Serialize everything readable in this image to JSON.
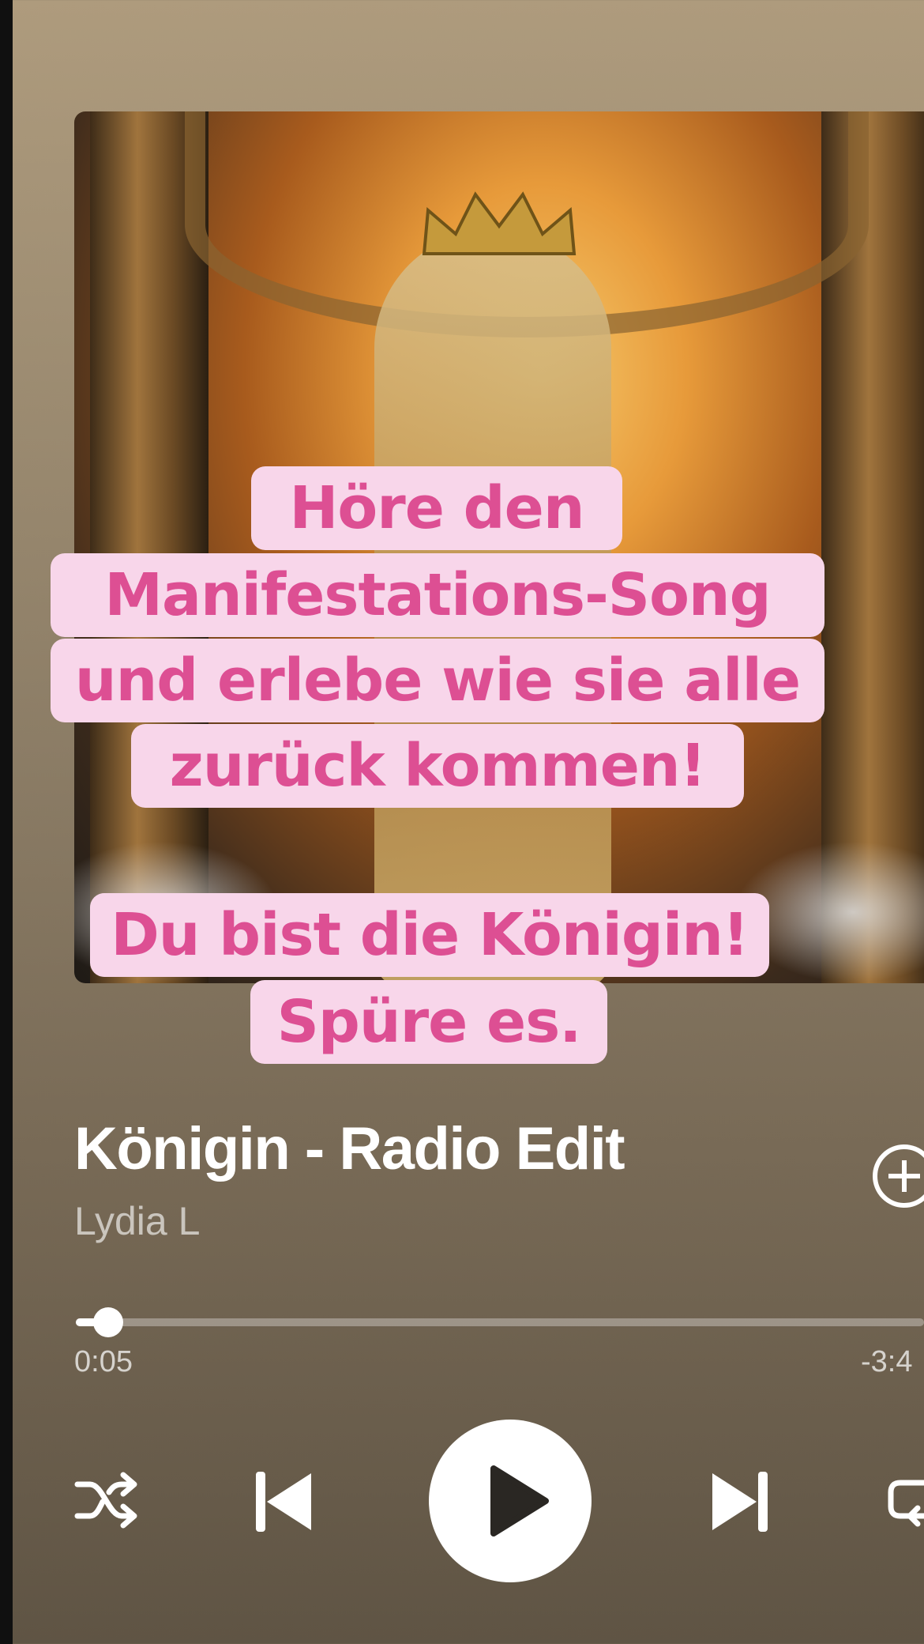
{
  "overlay": {
    "caption_1": [
      "Höre den",
      "Manifestations-Song",
      "und erlebe wie sie alle",
      "zurück kommen!"
    ],
    "caption_2": [
      "Du bist die Königin!",
      "Spüre es."
    ]
  },
  "track": {
    "title": "Königin - Radio Edit",
    "artist": "Lydia L"
  },
  "progress": {
    "elapsed": "0:05",
    "remaining": "-3:4",
    "fraction": 0.025
  },
  "controls": [
    "shuffle-icon",
    "previous-icon",
    "play-icon",
    "next-icon",
    "repeat-icon",
    "add-icon"
  ],
  "colors": {
    "caption_bg": "#f8d6ea",
    "caption_text": "#dd4f93",
    "player_bg_top": "#ae9b7d",
    "player_bg_bottom": "#5f5444"
  }
}
